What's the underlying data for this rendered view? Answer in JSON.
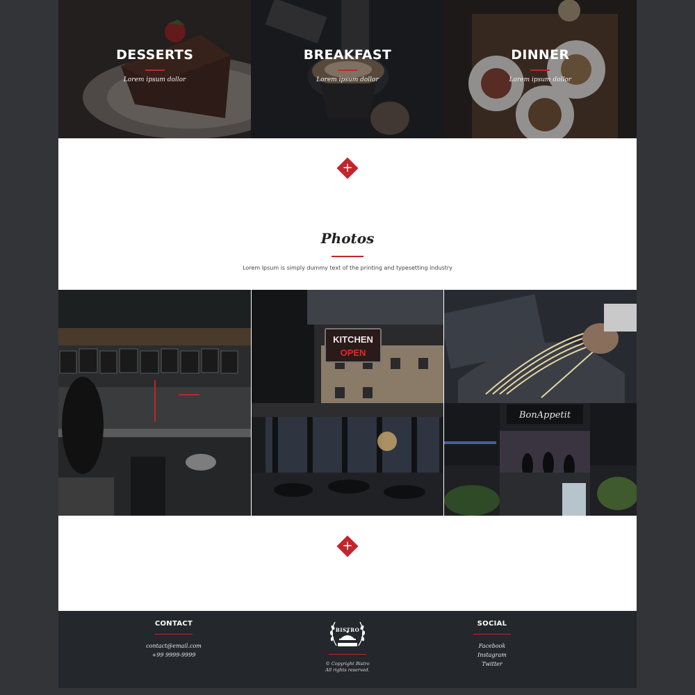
{
  "categories": [
    {
      "title": "DESSERTS",
      "subtitle": "Lorem ipsum dollor"
    },
    {
      "title": "BREAKFAST",
      "subtitle": "Lorem ipsum dollor"
    },
    {
      "title": "DINNER",
      "subtitle": "Lorem ipsum dollor"
    }
  ],
  "plus_symbol": "+",
  "photos": {
    "title": "Photos",
    "description": "Lorem Ipsum is simply dummy text of the printing and typesetting industry",
    "images": [
      {
        "name": "cafe-counter-photo",
        "sign_text": ""
      },
      {
        "name": "kitchen-open-sign-photo",
        "sign_text_1": "KITCHEN",
        "sign_text_2": "OPEN"
      },
      {
        "name": "pasta-making-photo"
      },
      {
        "name": "restaurant-interior-photo"
      },
      {
        "name": "bon-appetit-kitchen-photo",
        "sign_text": "BonAppetit"
      }
    ]
  },
  "footer": {
    "contact": {
      "heading": "CONTACT",
      "email": "contact@email.com",
      "phone": "+99 9999-9999"
    },
    "logo": {
      "text": "BISTRO"
    },
    "copyright": {
      "line1": "© Copyright Bistro",
      "line2": "All rights reserved."
    },
    "social": {
      "heading": "SOCIAL",
      "links": [
        "Facebook",
        "Instagram",
        "Twitter"
      ]
    }
  },
  "colors": {
    "accent": "#c0262c",
    "footer_bg": "#24272c",
    "outer_bg": "#333437"
  }
}
